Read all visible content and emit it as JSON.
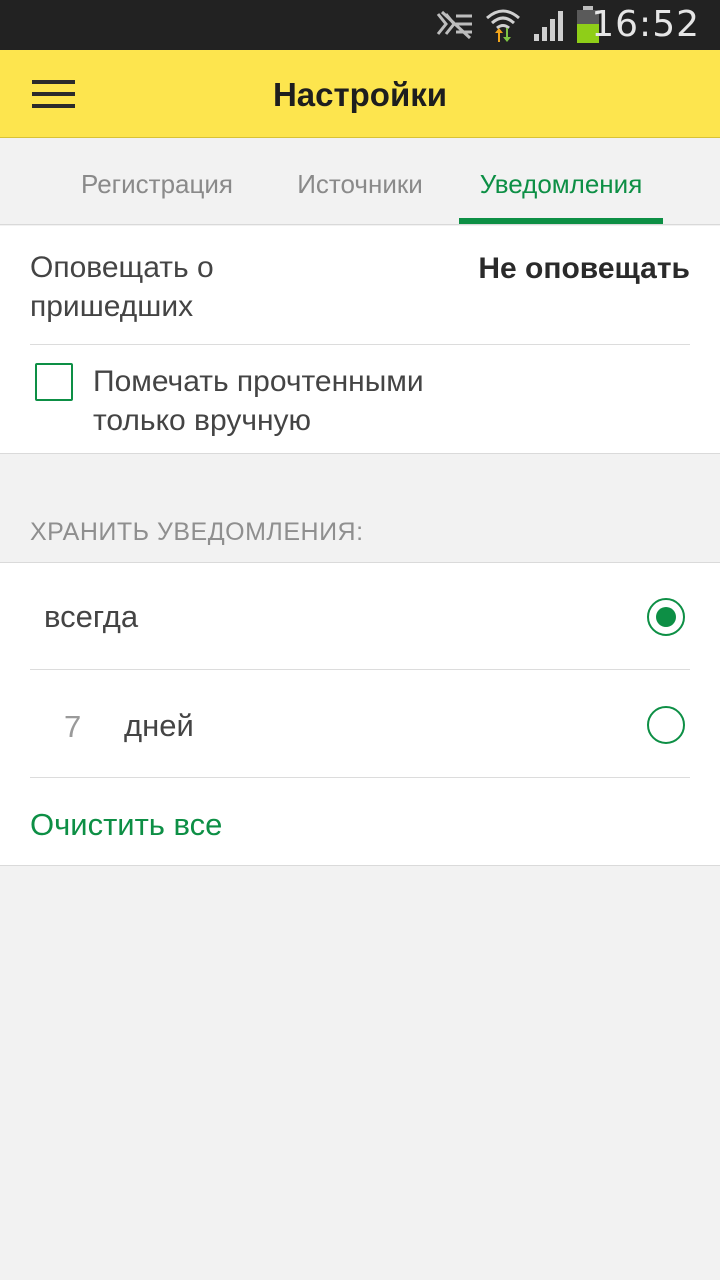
{
  "status_bar": {
    "time": "16:52",
    "icons": [
      "no-signal-icon",
      "wifi-icon",
      "cell-signal-icon",
      "battery-icon"
    ]
  },
  "toolbar": {
    "title": "Настройки",
    "menu_icon": "hamburger-menu-icon"
  },
  "tabs": [
    {
      "label": "Регистрация",
      "active": false
    },
    {
      "label": "Источники",
      "active": false
    },
    {
      "label": "Уведомления",
      "active": true
    }
  ],
  "notify": {
    "label": "Оповещать о пришедших",
    "value": "Не оповещать"
  },
  "mark_read": {
    "label": "Помечать прочтенными только вручную",
    "checked": false
  },
  "store": {
    "header": "ХРАНИТЬ УВЕДОМЛЕНИЯ:",
    "options": [
      {
        "label": "всегда",
        "selected": true
      },
      {
        "number": "7",
        "label": "дней",
        "selected": false
      }
    ],
    "clear_label": "Очистить все"
  },
  "colors": {
    "accent": "#0d8f45",
    "toolbar": "#fde54e",
    "status_bar": "#222222"
  }
}
